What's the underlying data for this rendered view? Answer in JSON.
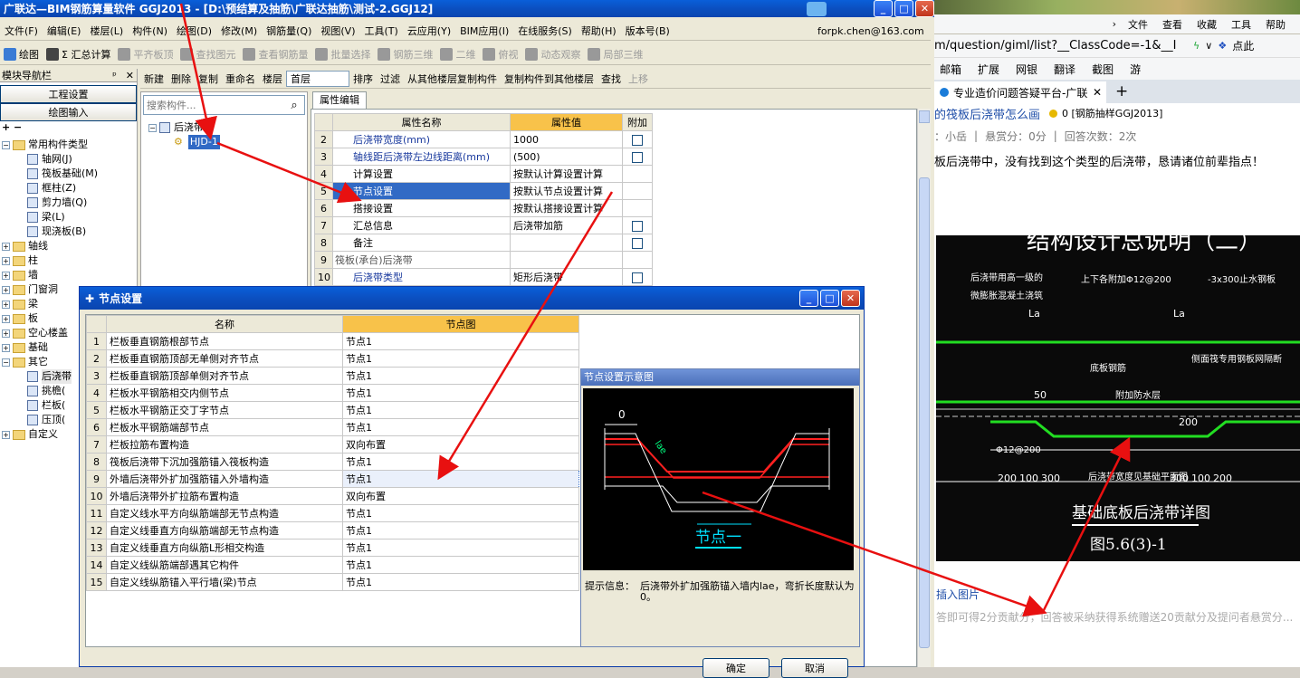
{
  "app": {
    "title": "广联达—BIM钢筋算量软件 GGJ2013 - [D:\\预结算及抽筋\\广联达抽筋\\测试-2.GGJ12]",
    "menu": [
      "文件(F)",
      "编辑(E)",
      "楼层(L)",
      "构件(N)",
      "绘图(D)",
      "修改(M)",
      "钢筋量(Q)",
      "视图(V)",
      "工具(T)",
      "云应用(Y)",
      "BIM应用(I)",
      "在线服务(S)",
      "帮助(H)",
      "版本号(B)"
    ],
    "user": "forpk.chen@163.com",
    "toolbar1": [
      "绘图",
      "Σ 汇总计算",
      "平齐板顶",
      "查找图元",
      "查看钢筋量",
      "批量选择",
      "钢筋三维",
      "二维",
      "俯视",
      "动态观察",
      "局部三维"
    ],
    "toolbar2": [
      "新建",
      "删除",
      "复制",
      "重命名",
      "楼层",
      "首层",
      "排序",
      "过滤",
      "从其他楼层复制构件",
      "复制构件到其他楼层",
      "查找",
      "上移"
    ]
  },
  "nav": {
    "title": "模块导航栏",
    "btn_project": "工程设置",
    "btn_draw": "绘图输入",
    "tree": [
      "常用构件类型",
      "轴网(J)",
      "筏板基础(M)",
      "框柱(Z)",
      "剪力墙(Q)",
      "梁(L)",
      "现浇板(B)",
      "轴线",
      "柱",
      "墙",
      "门窗洞",
      "梁",
      "板",
      "空心楼盖",
      "基础",
      "其它",
      "后浇带",
      "挑檐(",
      "栏板(",
      "压顶(",
      "自定义"
    ]
  },
  "component": {
    "search_placeholder": "搜索构件...",
    "root": "后浇带",
    "item": "HJD-1"
  },
  "props": {
    "tab": "属性编辑",
    "headers": [
      "属性名称",
      "属性值",
      "附加"
    ],
    "rows": [
      {
        "n": "2",
        "name": "后浇带宽度(mm)",
        "value": "1000"
      },
      {
        "n": "3",
        "name": "轴线距后浇带左边线距离(mm)",
        "value": "(500)"
      },
      {
        "n": "4",
        "name": "计算设置",
        "value": "按默认计算设置计算"
      },
      {
        "n": "5",
        "name": "节点设置",
        "value": "按默认节点设置计算"
      },
      {
        "n": "6",
        "name": "搭接设置",
        "value": "按默认搭接设置计算"
      },
      {
        "n": "7",
        "name": "汇总信息",
        "value": "后浇带加筋"
      },
      {
        "n": "8",
        "name": "备注",
        "value": ""
      },
      {
        "n": "9",
        "name": "筏板(承台)后浇带",
        "value": ""
      },
      {
        "n": "10",
        "name": "后浇带类型",
        "value": "矩形后浇带"
      }
    ]
  },
  "dialog": {
    "title": "节点设置",
    "headers": [
      "名称",
      "节点图"
    ],
    "rows": [
      {
        "n": "1",
        "name": "栏板垂直钢筋根部节点",
        "node": "节点1"
      },
      {
        "n": "2",
        "name": "栏板垂直钢筋顶部无单侧对齐节点",
        "node": "节点1"
      },
      {
        "n": "3",
        "name": "栏板垂直钢筋顶部单侧对齐节点",
        "node": "节点1"
      },
      {
        "n": "4",
        "name": "栏板水平钢筋相交内侧节点",
        "node": "节点1"
      },
      {
        "n": "5",
        "name": "栏板水平钢筋正交丁字节点",
        "node": "节点1"
      },
      {
        "n": "6",
        "name": "栏板水平钢筋端部节点",
        "node": "节点1"
      },
      {
        "n": "7",
        "name": "栏板拉筋布置构造",
        "node": "双向布置"
      },
      {
        "n": "8",
        "name": "筏板后浇带下沉加强筋锚入筏板构造",
        "node": "节点1"
      },
      {
        "n": "9",
        "name": "外墙后浇带外扩加强筋锚入外墙构造",
        "node": "节点1"
      },
      {
        "n": "10",
        "name": "外墙后浇带外扩拉筋布置构造",
        "node": "双向布置"
      },
      {
        "n": "11",
        "name": "自定义线水平方向纵筋端部无节点构造",
        "node": "节点1"
      },
      {
        "n": "12",
        "name": "自定义线垂直方向纵筋端部无节点构造",
        "node": "节点1"
      },
      {
        "n": "13",
        "name": "自定义线垂直方向纵筋L形相交构造",
        "node": "节点1"
      },
      {
        "n": "14",
        "name": "自定义线纵筋端部遇其它构件",
        "node": "节点1"
      },
      {
        "n": "15",
        "name": "自定义线纵筋锚入平行墙(梁)节点",
        "node": "节点1"
      }
    ],
    "preview_title": "节点设置示意图",
    "preview_dim": "0",
    "preview_lae": "lae",
    "preview_caption": "节点一",
    "hint_label": "提示信息：",
    "hint_text": "后浇带外扩加强筋锚入墙内lae，弯折长度默认为0。",
    "ok": "确定",
    "cancel": "取消"
  },
  "browser": {
    "menu": [
      "文件",
      "查看",
      "收藏",
      "工具",
      "帮助"
    ],
    "url": "m/question/giml/list?__ClassCode=-1&__I",
    "bookmarks": [
      "邮箱",
      "扩展",
      "网银",
      "翻译",
      "截图",
      "游"
    ],
    "search_hint": "点此",
    "tab_title": "专业造价问题答疑平台-广联达!",
    "question_title": "的筏板后浇带怎么画",
    "question_meta_tag": "0 [钢筋抽样GGJ2013]",
    "asker": "：小岳",
    "reward": "悬赏分：0分",
    "answers": "回答次数：2次",
    "question_text": "板后浇带中，没有找到这个类型的后浇带，恳请诸位前辈指点！",
    "drawing_header": "结构设计总说明（二）",
    "drawing_title": "基础底板后浇带详图",
    "drawing_fig": "图5.6(3)-1",
    "drawing_notes": [
      "后浇带用高一级的",
      "微膨胀混凝土浇筑",
      "上下各附加Φ12@200",
      "-3x300止水钢板",
      "底板钢筋",
      "附加防水层",
      "侧面筏专用钢板网隔断",
      "Φ12@200",
      "后浇带宽度见基础平面图"
    ],
    "drawing_dims": [
      "La",
      "La",
      "50",
      "200",
      "100",
      "300",
      "300",
      "100",
      "200",
      "200"
    ],
    "insert_image": "插入图片",
    "answer_hint": "答即可得2分贡献分，回答被采纳获得系统赠送20贡献分及提问者悬赏分..."
  }
}
